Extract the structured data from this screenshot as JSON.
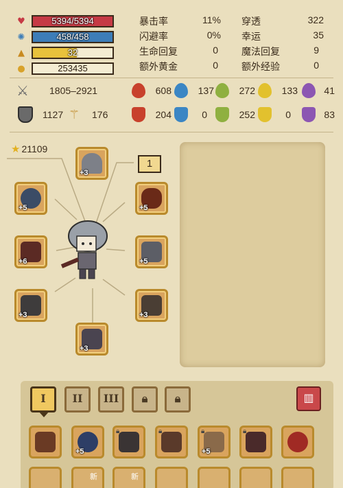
{
  "bars": {
    "hp": {
      "label": "5394/5394",
      "fill": 1.0,
      "color": "#c63a45",
      "icon": "heart-icon"
    },
    "mp": {
      "label": "458/458",
      "fill": 1.0,
      "color": "#3d7db8",
      "icon": "gear-icon"
    },
    "level": {
      "label": "32",
      "fill": 0.55,
      "color": "#e8c23c",
      "icon": "triangle-icon"
    },
    "gold": {
      "label": "253435",
      "fill": 0.0,
      "color": "#f4ecd2",
      "icon": "coins-icon"
    }
  },
  "stats_left": [
    {
      "label": "暴击率",
      "value": "11%"
    },
    {
      "label": "闪避率",
      "value": "0%"
    },
    {
      "label": "生命回复",
      "value": "0"
    },
    {
      "label": "额外黄金",
      "value": "0"
    }
  ],
  "stats_right": [
    {
      "label": "穿透",
      "value": "322"
    },
    {
      "label": "幸运",
      "value": "35"
    },
    {
      "label": "魔法回复",
      "value": "9"
    },
    {
      "label": "额外经验",
      "value": "0"
    }
  ],
  "attack": {
    "value": "1805–2921",
    "icon": "crossed-swords-icon"
  },
  "defense": {
    "value": "1127",
    "icon": "shield-icon"
  },
  "speed": {
    "value": "176",
    "icon": "staff-icon"
  },
  "elements_attack": [
    {
      "value": "608",
      "icon": "fire-icon",
      "color": "#c8412c"
    },
    {
      "value": "137",
      "icon": "water-icon",
      "color": "#3b86c4"
    },
    {
      "value": "272",
      "icon": "leaf-icon",
      "color": "#8fb040"
    },
    {
      "value": "133",
      "icon": "lightning-icon",
      "color": "#e2c12e"
    },
    {
      "value": "41",
      "icon": "poison-icon",
      "color": "#8c56b2"
    }
  ],
  "elements_defense": [
    {
      "value": "204",
      "icon": "fire-shield-icon",
      "color": "#c8412c"
    },
    {
      "value": "0",
      "icon": "water-shield-icon",
      "color": "#3b86c4"
    },
    {
      "value": "252",
      "icon": "leaf-shield-icon",
      "color": "#8fb040"
    },
    {
      "value": "0",
      "icon": "lightning-shield-icon",
      "color": "#e2c12e"
    },
    {
      "value": "83",
      "icon": "poison-shield-icon",
      "color": "#8c56b2"
    }
  ],
  "gold_stars": "21109",
  "hero_level": "1",
  "equipment": [
    {
      "name": "helmet",
      "plus": "+3"
    },
    {
      "name": "amulet",
      "plus": "+5"
    },
    {
      "name": "ring",
      "plus": "+5"
    },
    {
      "name": "weapon",
      "plus": "+6"
    },
    {
      "name": "armor",
      "plus": "+5"
    },
    {
      "name": "bracer",
      "plus": "+3"
    },
    {
      "name": "pants",
      "plus": "+3"
    },
    {
      "name": "boots",
      "plus": "+3"
    }
  ],
  "tabs": [
    "I",
    "II",
    "III",
    "",
    ""
  ],
  "inventory": [
    {
      "plus": "",
      "locked": false
    },
    {
      "plus": "+5",
      "locked": false
    },
    {
      "plus": "",
      "locked": true
    },
    {
      "plus": "",
      "locked": true
    },
    {
      "plus": "+5",
      "locked": true
    },
    {
      "plus": "",
      "locked": true
    },
    {
      "plus": "",
      "locked": false
    }
  ],
  "inventory_row2_badges": [
    "",
    "新",
    "新",
    "",
    "",
    "",
    ""
  ]
}
